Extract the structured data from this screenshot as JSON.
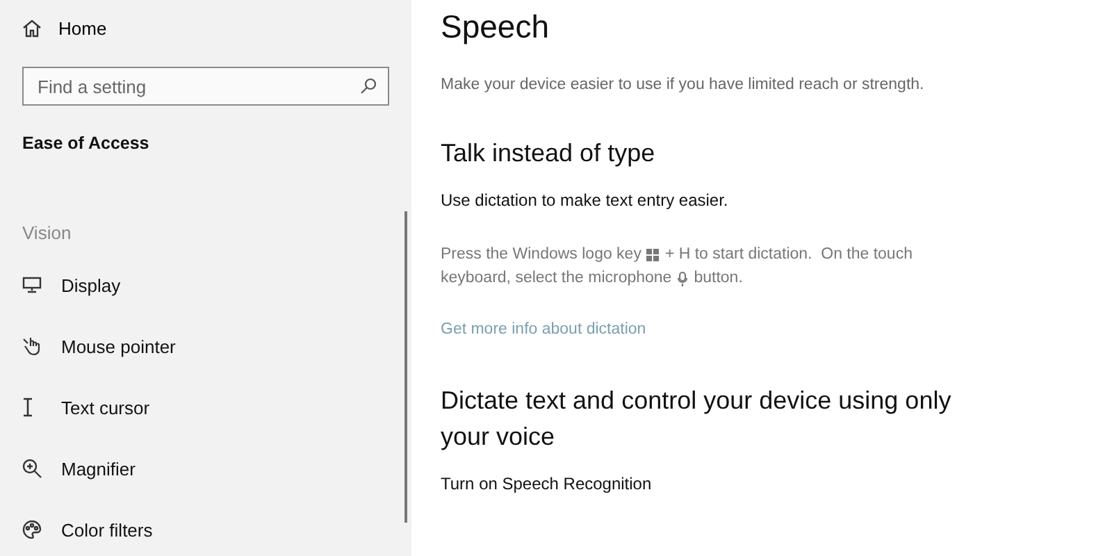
{
  "sidebar": {
    "home": "Home",
    "search": {
      "placeholder": "Find a setting"
    },
    "section": "Ease of Access",
    "group": "Vision",
    "items": [
      {
        "label": "Display"
      },
      {
        "label": "Mouse pointer"
      },
      {
        "label": "Text cursor"
      },
      {
        "label": "Magnifier"
      },
      {
        "label": "Color filters"
      }
    ]
  },
  "main": {
    "title": "Speech",
    "subtitle": "Make your device easier to use if you have limited reach or strength.",
    "sections": [
      {
        "heading": "Talk instead of type",
        "lead": "Use dictation to make text entry easier.",
        "lines": [
          [
            "Press the Windows logo key",
            "+ H to start dictation.  On the touch"
          ],
          [
            "keyboard, select the microphone",
            "button."
          ]
        ],
        "link": "Get more info about dictation"
      },
      {
        "heading": "Dictate text and control your device using only your voice",
        "lead": "Turn on Speech Recognition"
      }
    ]
  }
}
